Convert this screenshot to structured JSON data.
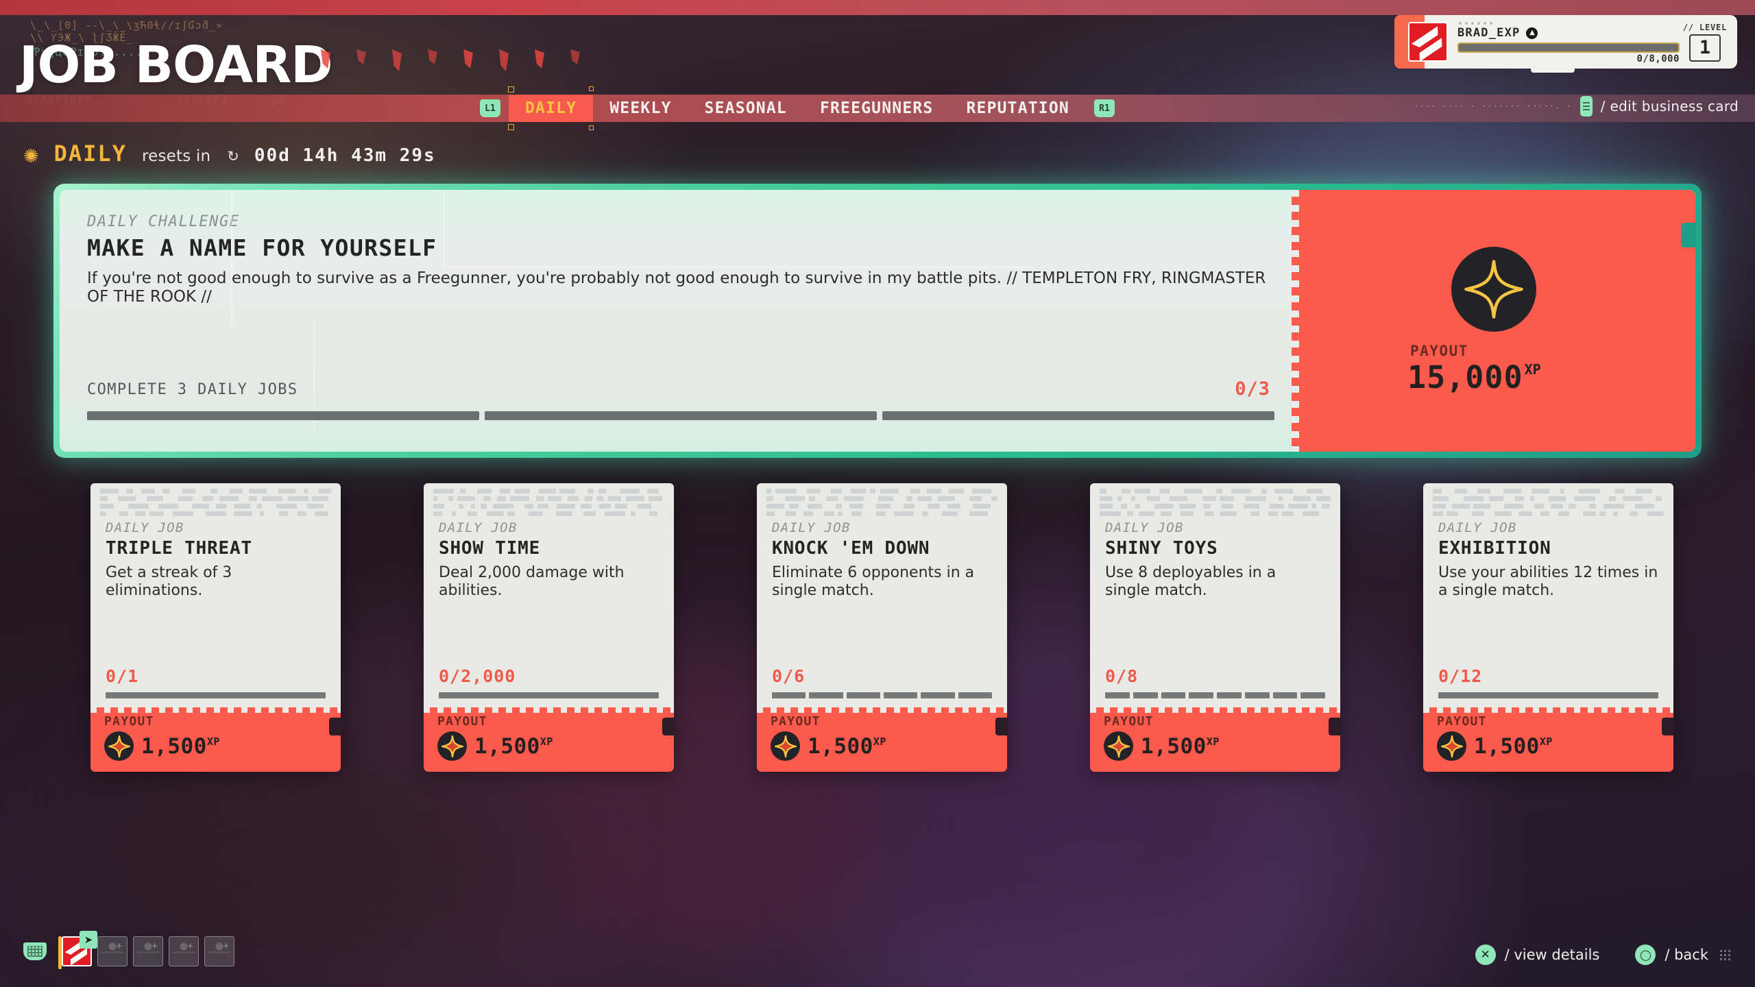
{
  "header": {
    "title": "JOB BOARD",
    "deco_lines": [
      "\\_\\_[0] --\\_\\_\\ʒЋ0ɬ//ɪʃƓɔƌ_»",
      "\\\\ ƳЭЖ_\\ ɭʃƷӁӖ_",
      "ɣƤɣɣЦƋƤɪ0ɒ......",
      "Ɓ↿ɅɤƳƖƌƤƳ..",
      "ʆʃɅӿƌƤɑ......ɣɤ"
    ]
  },
  "player": {
    "name": "BRAD_EXP",
    "platform_icon": "playstation-icon",
    "xp_text": "0/8,000",
    "xp_percent": 0,
    "level_label": "// LEVEL",
    "level_value": "1"
  },
  "nav": {
    "left_bumper": "L1",
    "right_bumper": "R1",
    "tabs": [
      {
        "label": "DAILY",
        "active": true
      },
      {
        "label": "WEEKLY",
        "active": false
      },
      {
        "label": "SEASONAL",
        "active": false
      },
      {
        "label": "FREEGUNNERS",
        "active": false
      },
      {
        "label": "REPUTATION",
        "active": false
      }
    ]
  },
  "edit_business_card": {
    "deco": "···· ···· · ······· ·····. ·",
    "label": "/ edit business card"
  },
  "section": {
    "star_icon": "star-icon",
    "title": "DAILY",
    "reset_prefix": "resets in",
    "clock_icon": "clock-icon",
    "timer": "00d 14h 43m 29s"
  },
  "hero": {
    "kicker": "DAILY CHALLENGE",
    "title": "MAKE A NAME FOR YOURSELF",
    "description": "If you're not good enough to survive as a Freegunner, you're probably not good enough to survive in my battle pits.  // TEMPLETON FRY, RINGMASTER OF THE ROOK //",
    "progress_label": "COMPLETE 3 DAILY JOBS",
    "progress_text": "0/3",
    "progress_segments": 3,
    "progress_filled": 0,
    "payout_caption": "PAYOUT",
    "payout_amount": "15,000",
    "payout_unit": "XP",
    "payout_icon": "sparkle-icon"
  },
  "jobs": [
    {
      "kicker": "DAILY JOB",
      "title": "TRIPLE THREAT",
      "description": "Get a streak of 3 eliminations.",
      "progress_text": "0/1",
      "segments": 1,
      "filled": 0,
      "payout_caption": "PAYOUT",
      "payout_amount": "1,500",
      "payout_unit": "XP",
      "payout_icon": "sparkle-icon"
    },
    {
      "kicker": "DAILY JOB",
      "title": "SHOW TIME",
      "description": "Deal 2,000 damage with abilities.",
      "progress_text": "0/2,000",
      "segments": 1,
      "filled": 0,
      "payout_caption": "PAYOUT",
      "payout_amount": "1,500",
      "payout_unit": "XP",
      "payout_icon": "sparkle-icon"
    },
    {
      "kicker": "DAILY JOB",
      "title": "KNOCK 'EM DOWN",
      "description": "Eliminate 6 opponents in a single match.",
      "progress_text": "0/6",
      "segments": 6,
      "filled": 0,
      "payout_caption": "PAYOUT",
      "payout_amount": "1,500",
      "payout_unit": "XP",
      "payout_icon": "sparkle-icon"
    },
    {
      "kicker": "DAILY JOB",
      "title": "SHINY TOYS",
      "description": "Use 8 deployables in a single match.",
      "progress_text": "0/8",
      "segments": 8,
      "filled": 0,
      "payout_caption": "PAYOUT",
      "payout_amount": "1,500",
      "payout_unit": "XP",
      "payout_icon": "sparkle-icon"
    },
    {
      "kicker": "DAILY JOB",
      "title": "EXHIBITION",
      "description": "Use your abilities 12 times in a single match.",
      "progress_text": "0/12",
      "segments": 1,
      "filled": 0,
      "payout_caption": "PAYOUT",
      "payout_amount": "1,500",
      "payout_unit": "XP",
      "payout_icon": "sparkle-icon"
    }
  ],
  "bottom_bar": {
    "basket_icon": "basket-icon",
    "squad_slots": [
      {
        "filled": true,
        "selected": true
      },
      {
        "filled": false,
        "selected": false
      },
      {
        "filled": false,
        "selected": false
      },
      {
        "filled": false,
        "selected": false
      },
      {
        "filled": false,
        "selected": false
      }
    ],
    "hints": [
      {
        "button": "X",
        "icon": "cross-button-icon",
        "label": "/ view details"
      },
      {
        "button": "O",
        "icon": "circle-button-icon",
        "label": "/ back"
      }
    ]
  },
  "colors": {
    "accent_red": "#fb5a4c",
    "accent_yellow": "#f5b43c",
    "accent_green": "#8fe6b8",
    "card_paper": "#e9e9e6",
    "nav_active_text": "#f6c343"
  }
}
